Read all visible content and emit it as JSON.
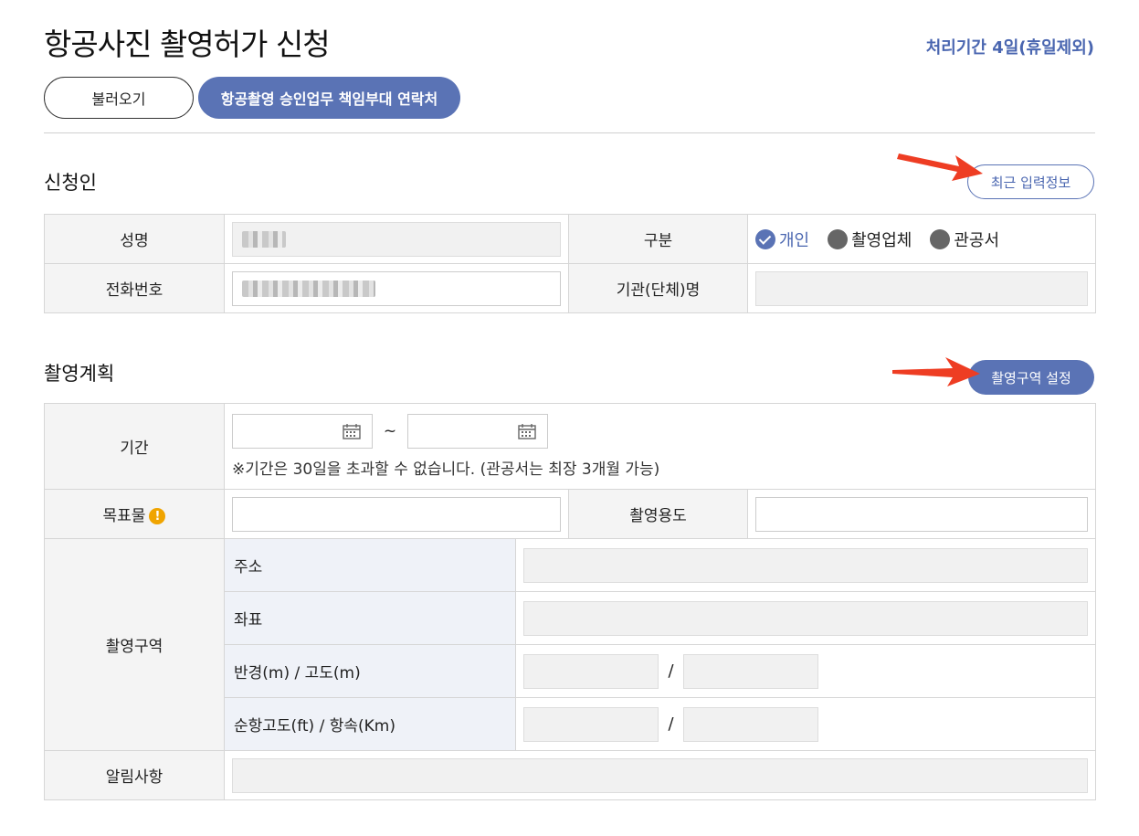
{
  "page": {
    "title": "항공사진 촬영허가 신청",
    "processing_period": "처리기간 4일(휴일제외)"
  },
  "actions": {
    "load_label": "불러오기",
    "contact_label": "항공촬영 승인업무 책임부대 연락처"
  },
  "applicant": {
    "section_title": "신청인",
    "recent_info_label": "최근 입력정보",
    "name_label": "성명",
    "phone_label": "전화번호",
    "category_label": "구분",
    "org_label": "기관(단체)명",
    "category_options": [
      {
        "label": "개인",
        "selected": true
      },
      {
        "label": "촬영업체",
        "selected": false
      },
      {
        "label": "관공서",
        "selected": false
      }
    ]
  },
  "plan": {
    "section_title": "촬영계획",
    "set_area_label": "촬영구역 설정",
    "period_label": "기간",
    "period_separator": "~",
    "period_note": "※기간은 30일을 초과할 수 없습니다. (관공서는 최장 3개월 가능)",
    "target_label": "목표물",
    "purpose_label": "촬영용도",
    "area_label": "촬영구역",
    "address_label": "주소",
    "coords_label": "좌표",
    "radius_alt_label": "반경(m) / 고도(m)",
    "cruise_label": "순항고도(ft) / 항속(Km)",
    "pair_separator": "/",
    "notice_label": "알림사항"
  },
  "colors": {
    "accent": "#5a73b5",
    "warning": "#f0a400",
    "arrow": "#ee3d23"
  }
}
